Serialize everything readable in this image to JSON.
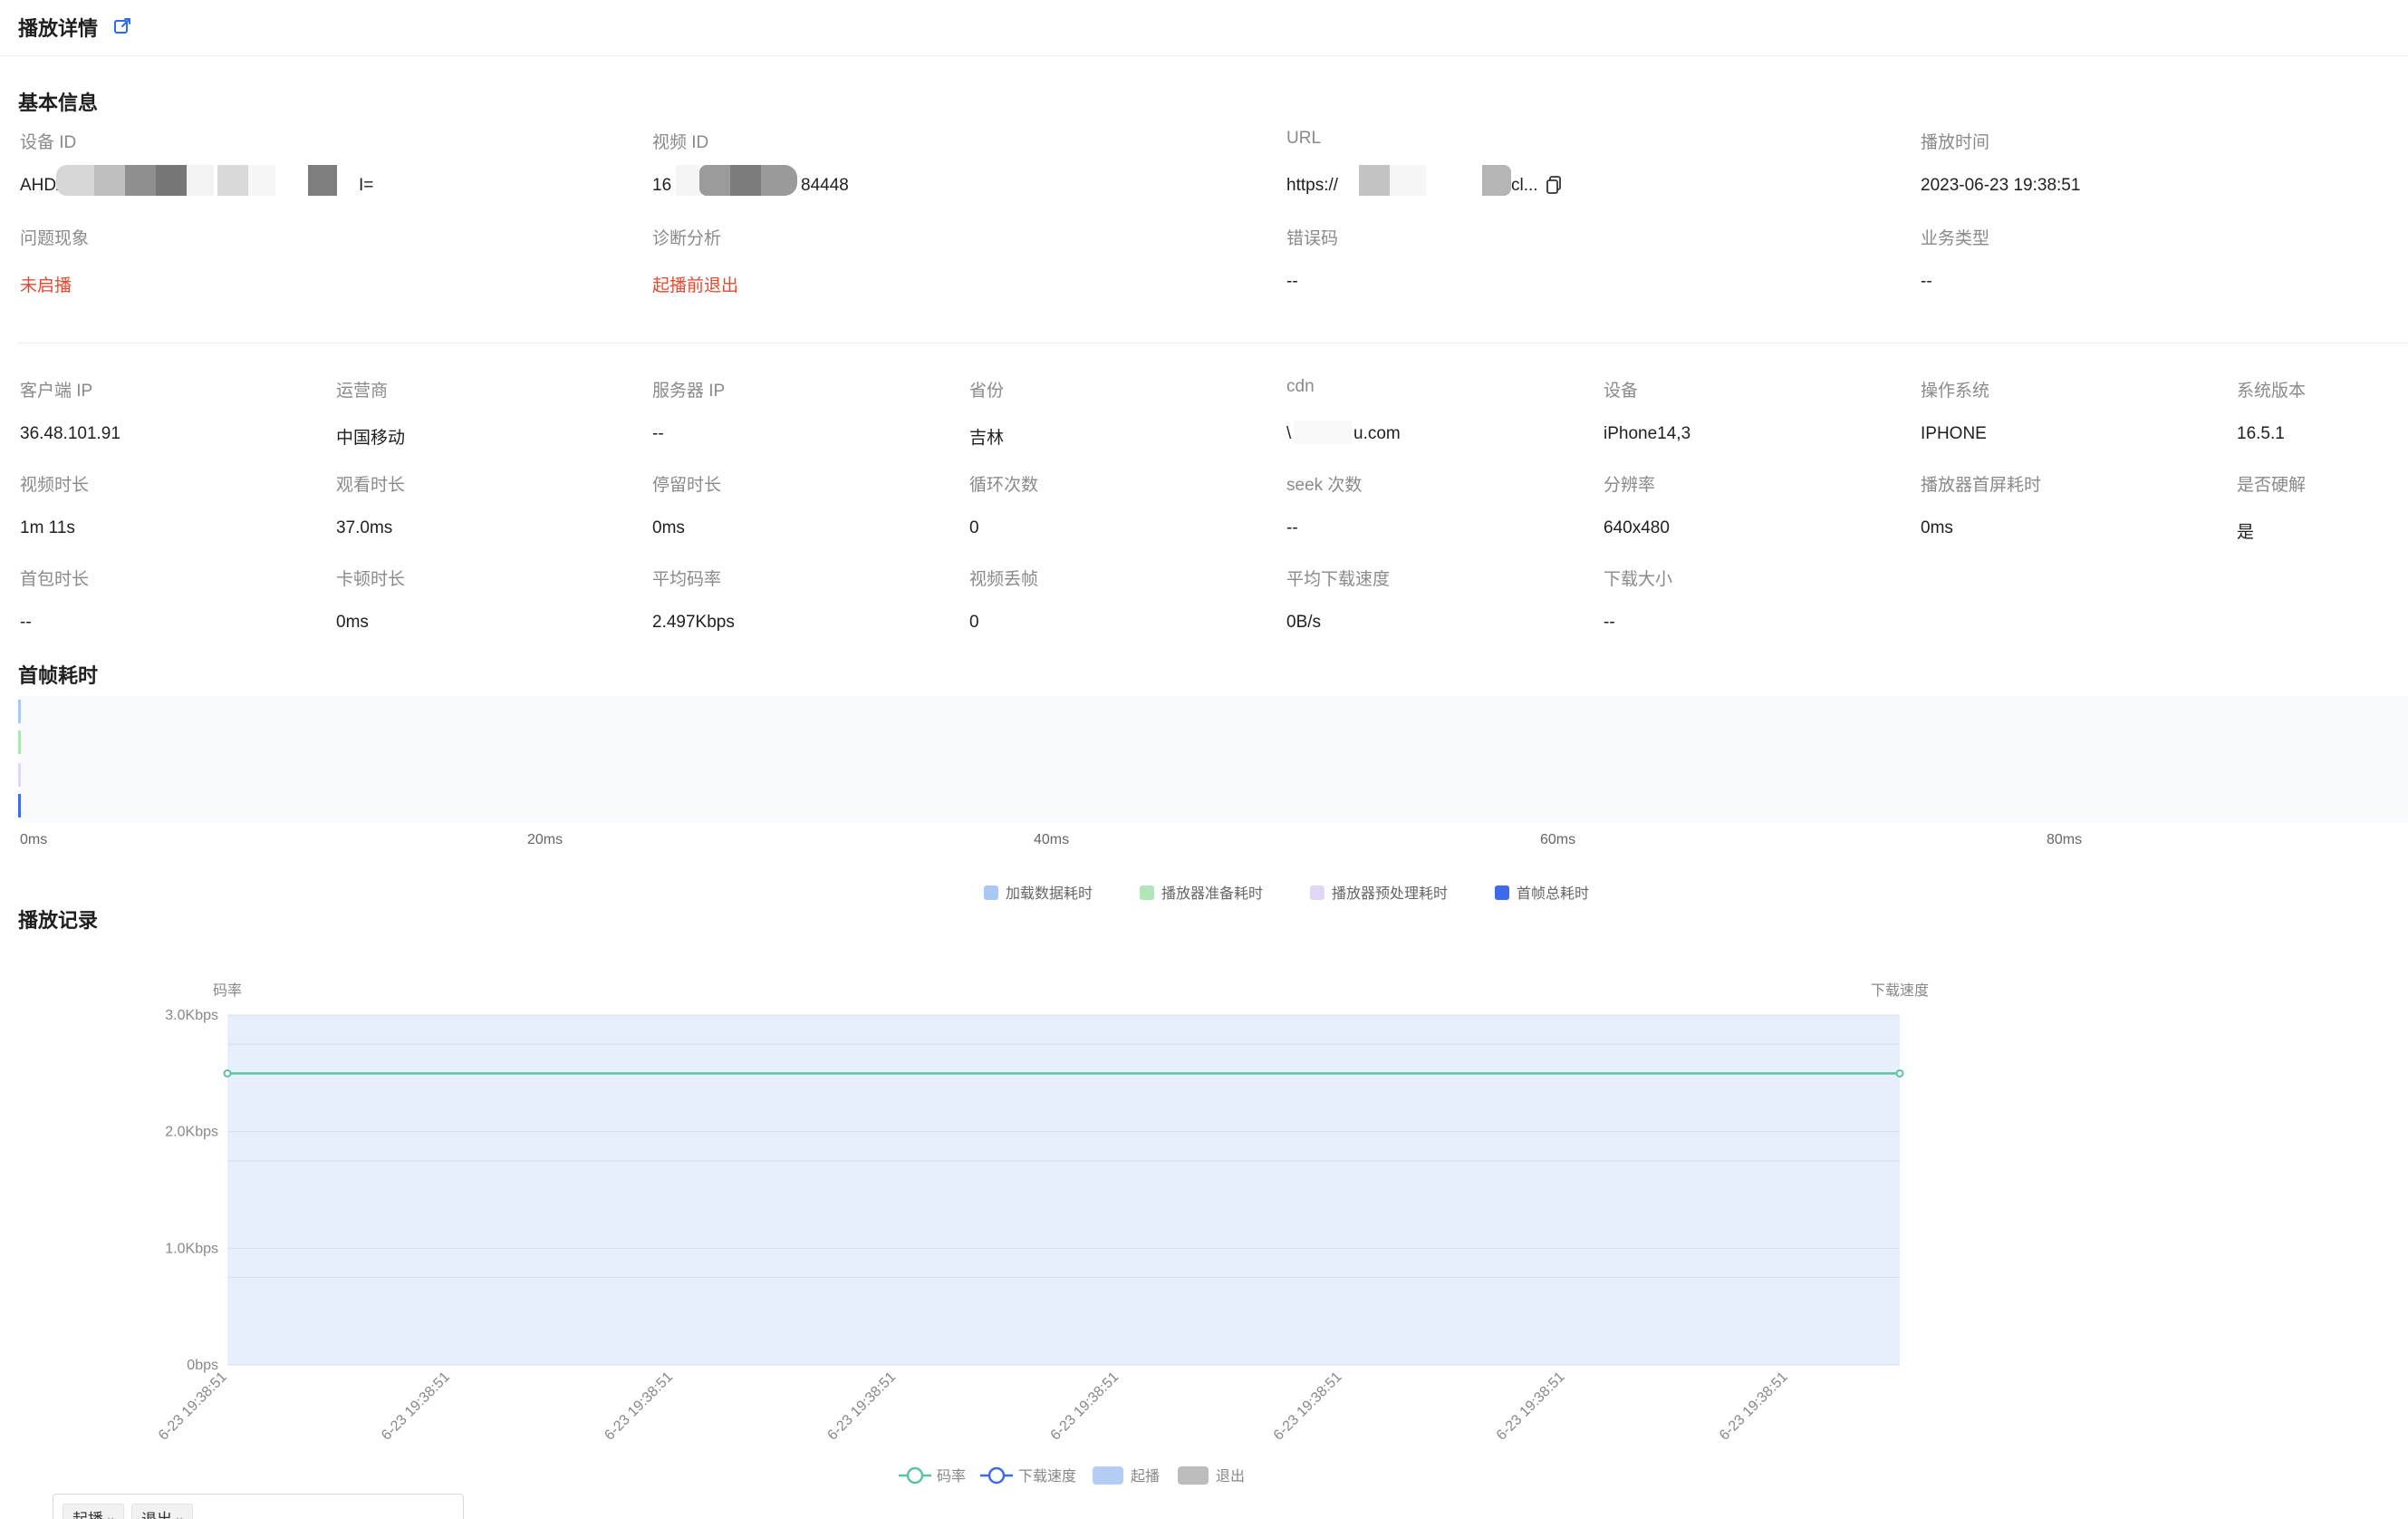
{
  "header": {
    "title": "播放详情",
    "icon": "external-link-icon"
  },
  "basic": {
    "title": "基本信息",
    "row1": [
      {
        "label": "设备 ID",
        "value": "AHD/",
        "value_tail": "I="
      },
      {
        "label": "视频 ID",
        "value": "16",
        "value_tail": "84448"
      },
      {
        "label": "URL",
        "value": "https://",
        "value_tail": "cl..."
      },
      {
        "label": "播放时间",
        "value": "2023-06-23 19:38:51"
      }
    ],
    "row2": [
      {
        "label": "问题现象",
        "value": "未启播"
      },
      {
        "label": "诊断分析",
        "value": "起播前退出"
      },
      {
        "label": "错误码",
        "value": "--"
      },
      {
        "label": "业务类型",
        "value": "--"
      }
    ]
  },
  "details": {
    "row1": [
      {
        "label": "客户端 IP",
        "value": "36.48.101.91"
      },
      {
        "label": "运营商",
        "value": "中国移动"
      },
      {
        "label": "服务器 IP",
        "value": "--"
      },
      {
        "label": "省份",
        "value": "吉林"
      },
      {
        "label": "cdn",
        "value": "\\",
        "value_tail": "u.com"
      },
      {
        "label": "设备",
        "value": "iPhone14,3"
      },
      {
        "label": "操作系统",
        "value": "IPHONE"
      },
      {
        "label": "系统版本",
        "value": "16.5.1"
      }
    ],
    "row2": [
      {
        "label": "视频时长",
        "value": "1m 11s"
      },
      {
        "label": "观看时长",
        "value": "37.0ms"
      },
      {
        "label": "停留时长",
        "value": "0ms"
      },
      {
        "label": "循环次数",
        "value": "0"
      },
      {
        "label": "seek 次数",
        "value": "--"
      },
      {
        "label": "分辨率",
        "value": "640x480"
      },
      {
        "label": "播放器首屏耗时",
        "value": "0ms"
      },
      {
        "label": "是否硬解",
        "value": "是"
      }
    ],
    "row3": [
      {
        "label": "首包时长",
        "value": "--"
      },
      {
        "label": "卡顿时长",
        "value": "0ms"
      },
      {
        "label": "平均码率",
        "value": "2.497Kbps"
      },
      {
        "label": "视频丢帧",
        "value": "0"
      },
      {
        "label": "平均下载速度",
        "value": "0B/s"
      },
      {
        "label": "下载大小",
        "value": "--"
      }
    ]
  },
  "first_frame": {
    "title": "首帧耗时",
    "ticks": [
      "0ms",
      "20ms",
      "40ms",
      "60ms",
      "80ms"
    ],
    "legend": [
      {
        "label": "加载数据耗时",
        "color": "#a9c8f7"
      },
      {
        "label": "播放器准备耗时",
        "color": "#b2e6b8"
      },
      {
        "label": "播放器预处理耗时",
        "color": "#e2d6f5"
      },
      {
        "label": "首帧总耗时",
        "color": "#3e6bea"
      }
    ]
  },
  "play_record": {
    "title": "播放记录",
    "chart_data": {
      "type": "line",
      "categories": [
        "6-23 19:38:51",
        "6-23 19:38:51",
        "6-23 19:38:51",
        "6-23 19:38:51",
        "6-23 19:38:51",
        "6-23 19:38:51",
        "6-23 19:38:51",
        "6-23 19:38:51"
      ],
      "series": [
        {
          "name": "码率",
          "values": [
            2.5,
            2.5
          ],
          "unit": "Kbps",
          "color": "#5ec3a0"
        },
        {
          "name": "下载速度",
          "values": [],
          "color": "#3e6bea"
        }
      ],
      "bands": [
        {
          "name": "起播",
          "color": "#b4cdf5"
        },
        {
          "name": "退出",
          "color": "#bdbdbd"
        }
      ],
      "ylabel_left": "码率",
      "ylabel_right": "下载速度",
      "yticks": [
        "0bps",
        "1.0Kbps",
        "2.0Kbps",
        "3.0Kbps"
      ],
      "ylim": [
        0,
        3
      ],
      "shaded_region": "起播",
      "grid": true,
      "legend_position": "bottom-center"
    },
    "filter_tags": [
      {
        "label": "起播",
        "close": "×"
      },
      {
        "label": "退出",
        "close": "×"
      }
    ]
  }
}
